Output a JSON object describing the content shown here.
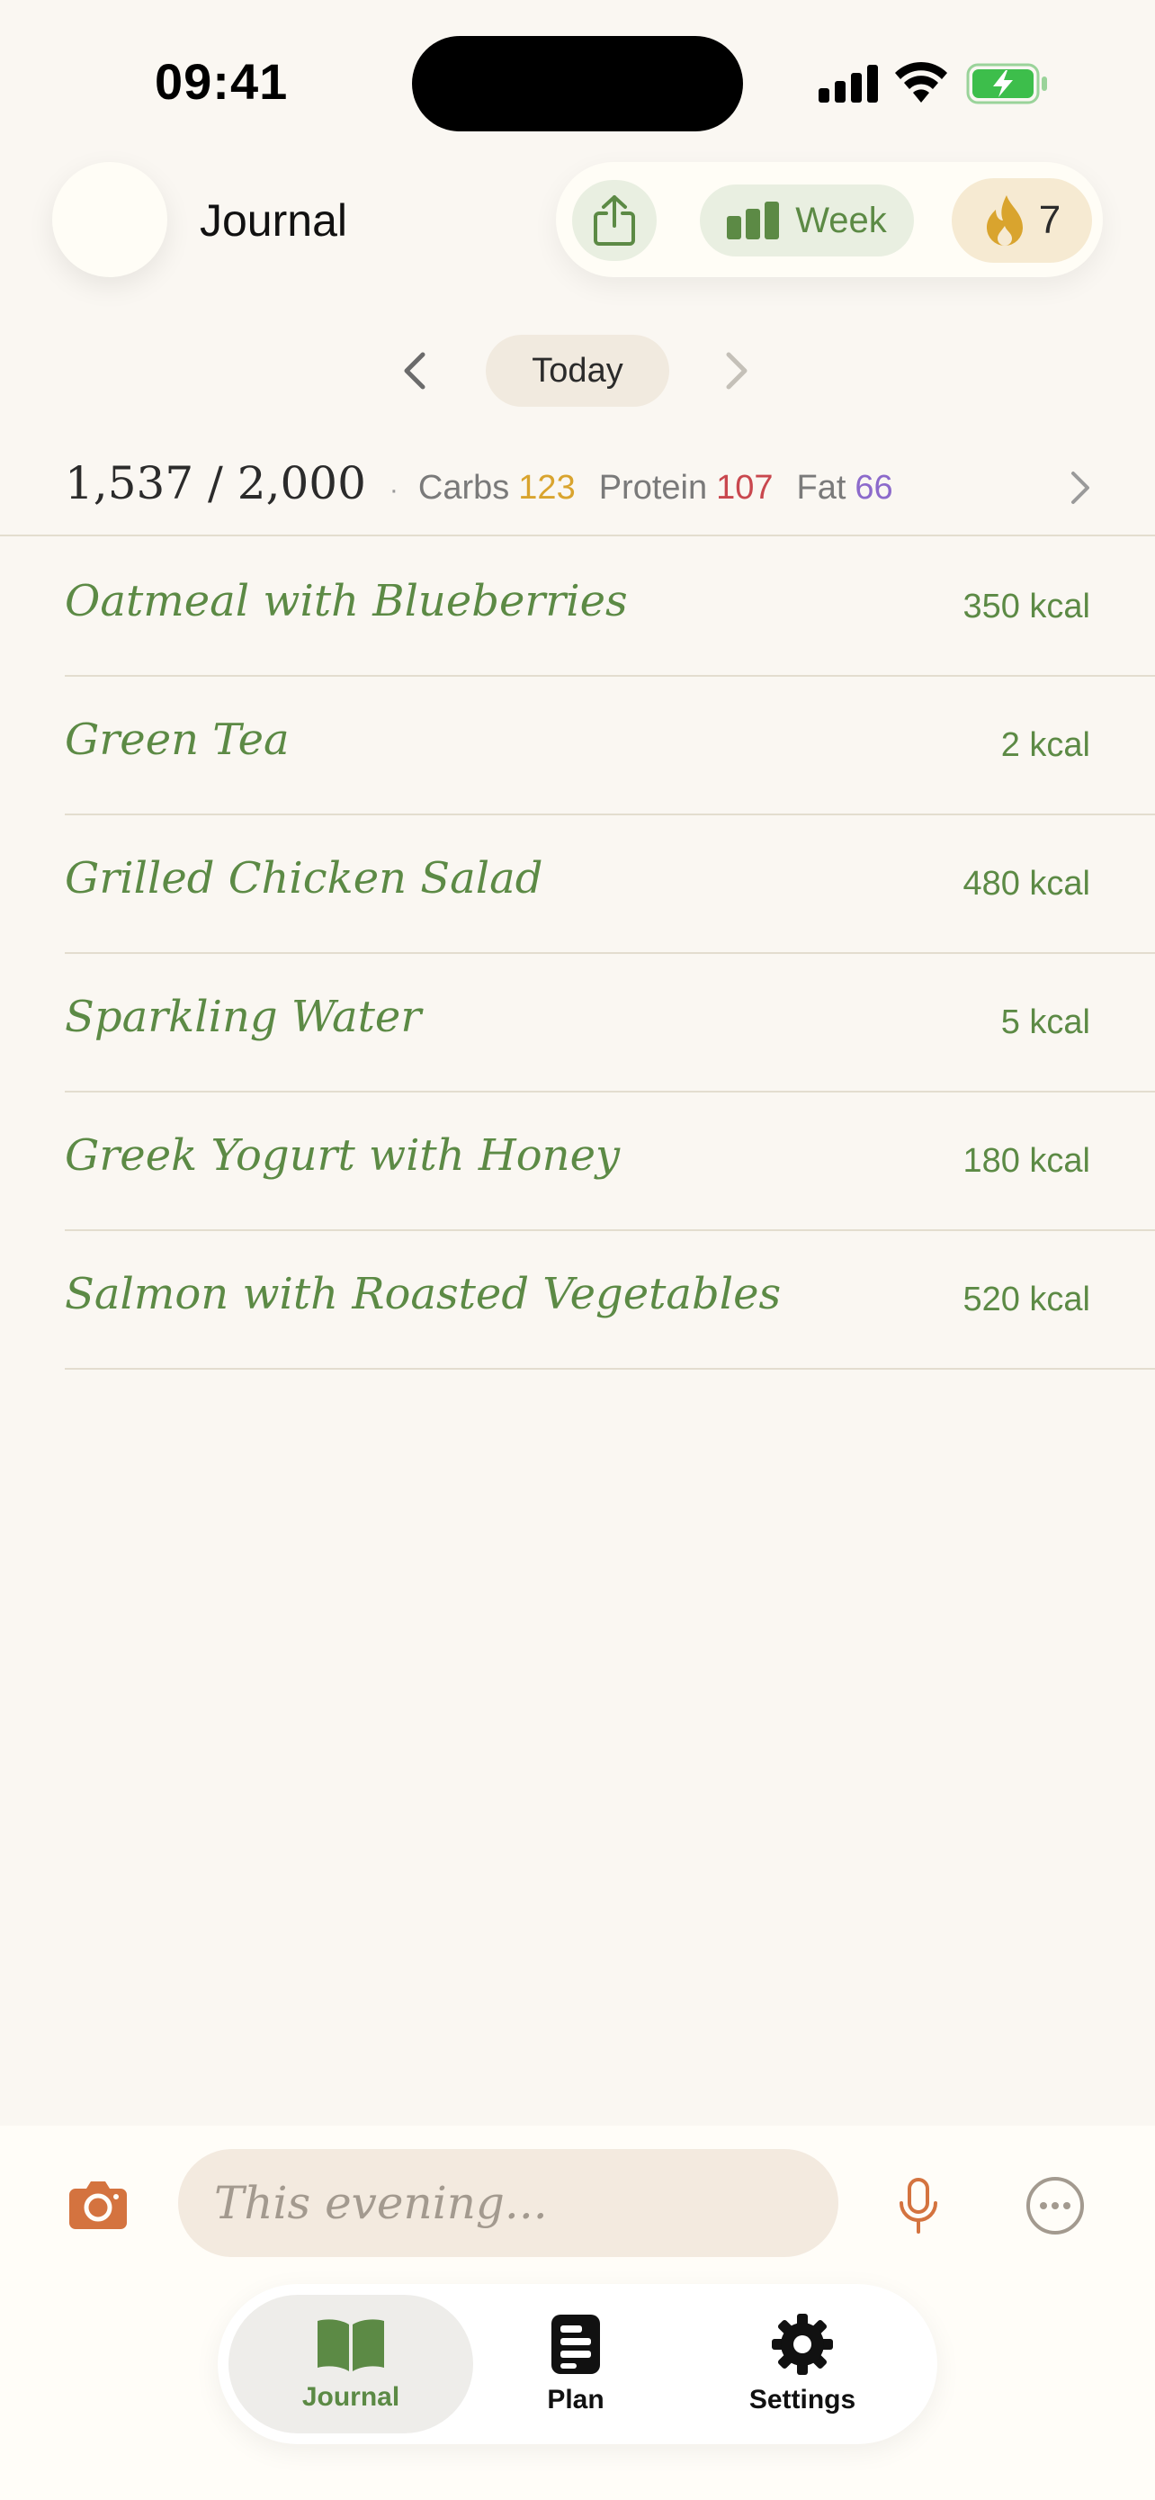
{
  "status_bar": {
    "time": "09:41"
  },
  "header": {
    "title": "Journal",
    "week_label": "Week",
    "streak_count": "7"
  },
  "day_nav": {
    "label": "Today"
  },
  "summary": {
    "calories": "1,537 / 2,000",
    "separator": "·",
    "carbs_label": "Carbs",
    "carbs_value": "123",
    "protein_label": "Protein",
    "protein_value": "107",
    "fat_label": "Fat",
    "fat_value": "66"
  },
  "foods": [
    {
      "name": "Oatmeal with Blueberries",
      "kcal": "350 kcal"
    },
    {
      "name": "Green Tea",
      "kcal": "2 kcal"
    },
    {
      "name": "Grilled Chicken Salad",
      "kcal": "480 kcal"
    },
    {
      "name": "Sparkling Water",
      "kcal": "5 kcal"
    },
    {
      "name": "Greek Yogurt with Honey",
      "kcal": "180 kcal"
    },
    {
      "name": "Salmon with Roasted Vegetables",
      "kcal": "520 kcal"
    }
  ],
  "composer": {
    "placeholder": "This evening..."
  },
  "tabs": [
    {
      "label": "Journal"
    },
    {
      "label": "Plan"
    },
    {
      "label": "Settings"
    }
  ],
  "colors": {
    "accent_green": "#5C8A45",
    "carbs": "#D9A42E",
    "protein": "#C9474E",
    "fat": "#8C6ACB",
    "camera_orange": "#D4733F",
    "background": "#FAF7F2"
  },
  "icons": [
    "share-icon",
    "bar-chart-icon",
    "flame-icon",
    "chevron-left-icon",
    "chevron-right-icon",
    "camera-icon",
    "microphone-icon",
    "more-icon",
    "book-icon",
    "document-icon",
    "gear-icon"
  ]
}
